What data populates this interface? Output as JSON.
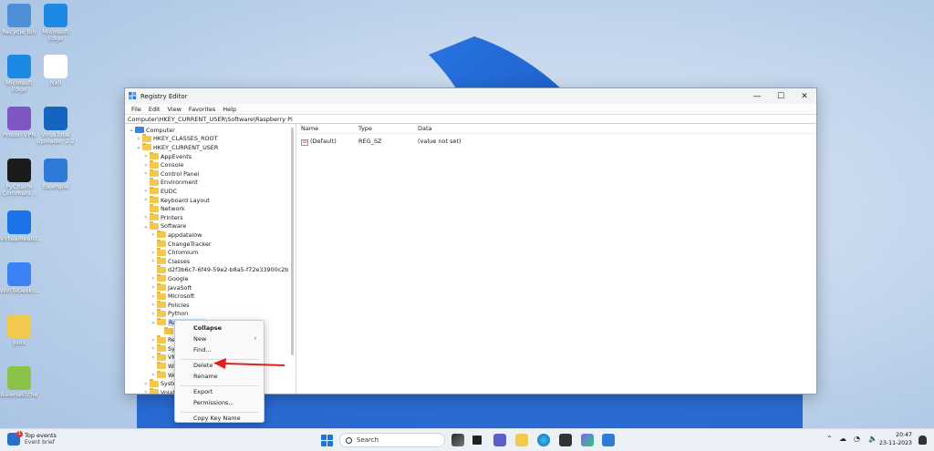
{
  "desktop": {
    "icons": [
      {
        "label": "Recycle Bin",
        "icon": "recycle-bin-icon"
      },
      {
        "label": "Microsoft Edge",
        "icon": "edge-icon"
      },
      {
        "label": "Microsoft Edge",
        "icon": "edge-icon"
      },
      {
        "label": "Nxll",
        "icon": "file-icon"
      },
      {
        "label": "Proton VPN",
        "icon": "vpn-icon"
      },
      {
        "label": "VirusTotal Uploader 2.2",
        "icon": "virustotal-icon"
      },
      {
        "label": "PyCharm Communi...",
        "icon": "pycharm-icon"
      },
      {
        "label": "Example",
        "icon": "example-icon"
      },
      {
        "label": "VirtualRealU...",
        "icon": "app-icon"
      },
      {
        "label": "WinToDeski...",
        "icon": "app-icon"
      },
      {
        "label": "Jobs",
        "icon": "folder-icon"
      },
      {
        "label": "BalenaEtche",
        "icon": "balena-icon"
      }
    ]
  },
  "window": {
    "title": "Registry Editor",
    "menu": [
      "File",
      "Edit",
      "View",
      "Favorites",
      "Help"
    ],
    "address": "Computer\\HKEY_CURRENT_USER\\Software\\Raspberry Pi",
    "tree": [
      {
        "label": "Computer",
        "indent": 0,
        "chev": "v",
        "icon": "pc"
      },
      {
        "label": "HKEY_CLASSES_ROOT",
        "indent": 1,
        "chev": ">"
      },
      {
        "label": "HKEY_CURRENT_USER",
        "indent": 1,
        "chev": "v"
      },
      {
        "label": "AppEvents",
        "indent": 2,
        "chev": ">"
      },
      {
        "label": "Console",
        "indent": 2,
        "chev": ">"
      },
      {
        "label": "Control Panel",
        "indent": 2,
        "chev": ">"
      },
      {
        "label": "Environment",
        "indent": 2,
        "chev": ""
      },
      {
        "label": "EUDC",
        "indent": 2,
        "chev": ">"
      },
      {
        "label": "Keyboard Layout",
        "indent": 2,
        "chev": ">"
      },
      {
        "label": "Network",
        "indent": 2,
        "chev": ""
      },
      {
        "label": "Printers",
        "indent": 2,
        "chev": ">"
      },
      {
        "label": "Software",
        "indent": 2,
        "chev": "v"
      },
      {
        "label": "appdatalow",
        "indent": 3,
        "chev": ">"
      },
      {
        "label": "ChangeTracker",
        "indent": 3,
        "chev": ""
      },
      {
        "label": "Chromium",
        "indent": 3,
        "chev": ">"
      },
      {
        "label": "Classes",
        "indent": 3,
        "chev": ">"
      },
      {
        "label": "d2f3b6c7-6f49-59e2-b8a5-f72e33900c2b",
        "indent": 3,
        "chev": ""
      },
      {
        "label": "Google",
        "indent": 3,
        "chev": ">"
      },
      {
        "label": "JavaSoft",
        "indent": 3,
        "chev": ">"
      },
      {
        "label": "Microsoft",
        "indent": 3,
        "chev": ">"
      },
      {
        "label": "Policies",
        "indent": 3,
        "chev": ">"
      },
      {
        "label": "Python",
        "indent": 3,
        "chev": ">"
      },
      {
        "label": "Raspberry Pi",
        "indent": 3,
        "chev": "v",
        "selected": true
      },
      {
        "label": "",
        "indent": 4,
        "chev": ""
      },
      {
        "label": "Re",
        "indent": 3,
        "chev": ">"
      },
      {
        "label": "Sys",
        "indent": 3,
        "chev": ">"
      },
      {
        "label": "VM",
        "indent": 3,
        "chev": ">"
      },
      {
        "label": "Wi",
        "indent": 3,
        "chev": ""
      },
      {
        "label": "Wo",
        "indent": 3,
        "chev": ">"
      },
      {
        "label": "Systen",
        "indent": 2,
        "chev": ">"
      },
      {
        "label": "Volatil",
        "indent": 2,
        "chev": ">"
      }
    ],
    "columns": {
      "name": "Name",
      "type": "Type",
      "data": "Data"
    },
    "rows": [
      {
        "name": "(Default)",
        "type": "REG_SZ",
        "data": "(value not set)"
      }
    ]
  },
  "context_menu": {
    "items": [
      {
        "label": "Collapse",
        "bold": true
      },
      {
        "label": "New",
        "submenu": true
      },
      {
        "label": "Find..."
      },
      {
        "sep": true
      },
      {
        "label": "Delete"
      },
      {
        "label": "Rename"
      },
      {
        "sep": true
      },
      {
        "label": "Export"
      },
      {
        "label": "Permissions..."
      },
      {
        "sep": true
      },
      {
        "label": "Copy Key Name"
      }
    ]
  },
  "taskbar": {
    "weather_title": "Top events",
    "weather_sub": "Event brief",
    "badge": "1",
    "search_label": "Search",
    "time": "20:47",
    "date": "23-11-2023",
    "colors": {
      "accent": "#1a78d4",
      "arrow": "#e0211b"
    }
  }
}
